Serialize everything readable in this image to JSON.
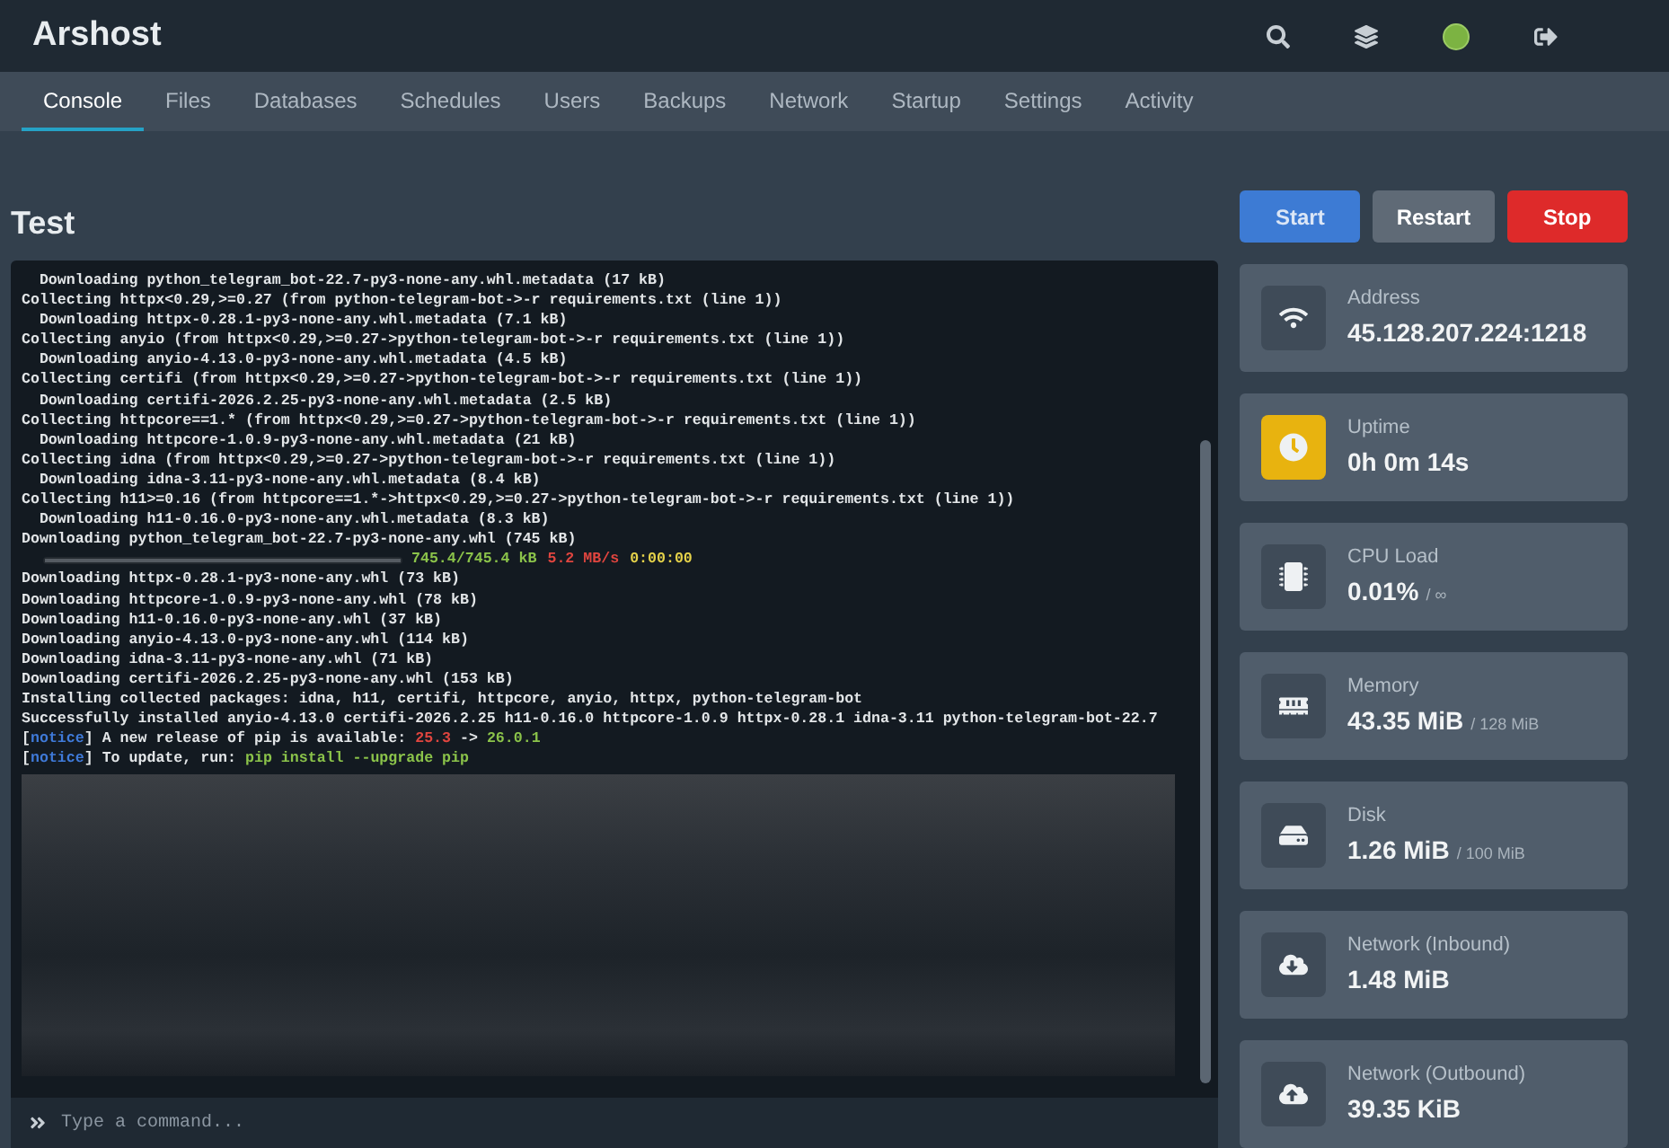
{
  "header": {
    "brand": "Arshost"
  },
  "tabs": [
    {
      "label": "Console",
      "selected": true
    },
    {
      "label": "Files",
      "selected": false
    },
    {
      "label": "Databases",
      "selected": false
    },
    {
      "label": "Schedules",
      "selected": false
    },
    {
      "label": "Users",
      "selected": false
    },
    {
      "label": "Backups",
      "selected": false
    },
    {
      "label": "Network",
      "selected": false
    },
    {
      "label": "Startup",
      "selected": false
    },
    {
      "label": "Settings",
      "selected": false
    },
    {
      "label": "Activity",
      "selected": false
    }
  ],
  "server": {
    "name": "Test"
  },
  "power_buttons": [
    {
      "label": "Start",
      "kind": "start"
    },
    {
      "label": "Restart",
      "kind": "restart"
    },
    {
      "label": "Stop",
      "kind": "stop"
    }
  ],
  "console": {
    "lines": [
      {
        "kind": "text",
        "segments": [
          {
            "text": "  Downloading python_telegram_bot-22.7-py3-none-any.whl.metadata (17 kB)"
          }
        ]
      },
      {
        "kind": "text",
        "segments": [
          {
            "text": "Collecting httpx<0.29,>=0.27 (from python-telegram-bot->-r requirements.txt (line 1))"
          }
        ]
      },
      {
        "kind": "text",
        "segments": [
          {
            "text": "  Downloading httpx-0.28.1-py3-none-any.whl.metadata (7.1 kB)"
          }
        ]
      },
      {
        "kind": "text",
        "segments": [
          {
            "text": "Collecting anyio (from httpx<0.29,>=0.27->python-telegram-bot->-r requirements.txt (line 1))"
          }
        ]
      },
      {
        "kind": "text",
        "segments": [
          {
            "text": "  Downloading anyio-4.13.0-py3-none-any.whl.metadata (4.5 kB)"
          }
        ]
      },
      {
        "kind": "text",
        "segments": [
          {
            "text": "Collecting certifi (from httpx<0.29,>=0.27->python-telegram-bot->-r requirements.txt (line 1))"
          }
        ]
      },
      {
        "kind": "text",
        "segments": [
          {
            "text": "  Downloading certifi-2026.2.25-py3-none-any.whl.metadata (2.5 kB)"
          }
        ]
      },
      {
        "kind": "text",
        "segments": [
          {
            "text": "Collecting httpcore==1.* (from httpx<0.29,>=0.27->python-telegram-bot->-r requirements.txt (line 1))"
          }
        ]
      },
      {
        "kind": "text",
        "segments": [
          {
            "text": "  Downloading httpcore-1.0.9-py3-none-any.whl.metadata (21 kB)"
          }
        ]
      },
      {
        "kind": "text",
        "segments": [
          {
            "text": "Collecting idna (from httpx<0.29,>=0.27->python-telegram-bot->-r requirements.txt (line 1))"
          }
        ]
      },
      {
        "kind": "text",
        "segments": [
          {
            "text": "  Downloading idna-3.11-py3-none-any.whl.metadata (8.4 kB)"
          }
        ]
      },
      {
        "kind": "text",
        "segments": [
          {
            "text": "Collecting h11>=0.16 (from httpcore==1.*->httpx<0.29,>=0.27->python-telegram-bot->-r requirements.txt (line 1))"
          }
        ]
      },
      {
        "kind": "text",
        "segments": [
          {
            "text": "  Downloading h11-0.16.0-py3-none-any.whl.metadata (8.3 kB)"
          }
        ]
      },
      {
        "kind": "text",
        "segments": [
          {
            "text": "Downloading python_telegram_bot-22.7-py3-none-any.whl (745 kB)"
          }
        ]
      },
      {
        "kind": "progress",
        "level": 1,
        "segments": [
          {
            "text": "745.4/745.4 kB",
            "color": "#8bc34a"
          },
          {
            "text": "5.2 MB/s",
            "color": "#e0453f"
          },
          {
            "text": "0:00:00",
            "color": "#e6d34a"
          }
        ]
      },
      {
        "kind": "text",
        "segments": [
          {
            "text": "Downloading httpx-0.28.1-py3-none-any.whl (73 kB)"
          }
        ]
      },
      {
        "kind": "text",
        "segments": [
          {
            "text": "Downloading httpcore-1.0.9-py3-none-any.whl (78 kB)"
          }
        ]
      },
      {
        "kind": "text",
        "segments": [
          {
            "text": "Downloading h11-0.16.0-py3-none-any.whl (37 kB)"
          }
        ]
      },
      {
        "kind": "text",
        "segments": [
          {
            "text": "Downloading anyio-4.13.0-py3-none-any.whl (114 kB)"
          }
        ]
      },
      {
        "kind": "text",
        "segments": [
          {
            "text": "Downloading idna-3.11-py3-none-any.whl (71 kB)"
          }
        ]
      },
      {
        "kind": "text",
        "segments": [
          {
            "text": "Downloading certifi-2026.2.25-py3-none-any.whl (153 kB)"
          }
        ]
      },
      {
        "kind": "text",
        "segments": [
          {
            "text": "Installing collected packages: idna, h11, certifi, httpcore, anyio, httpx, python-telegram-bot"
          }
        ]
      },
      {
        "kind": "text",
        "segments": [
          {
            "text": "Successfully installed anyio-4.13.0 certifi-2026.2.25 h11-0.16.0 httpcore-1.0.9 httpx-0.28.1 idna-3.11 python-telegram-bot-22.7"
          }
        ]
      },
      {
        "kind": "text",
        "segments": [
          {
            "text": "["
          },
          {
            "text": "notice",
            "color": "#3f7ad9"
          },
          {
            "text": "] A new release of pip is available: "
          },
          {
            "text": "25.3",
            "color": "#e0453f"
          },
          {
            "text": " -> "
          },
          {
            "text": "26.0.1",
            "color": "#8bc34a"
          }
        ]
      },
      {
        "kind": "text",
        "segments": [
          {
            "text": "["
          },
          {
            "text": "notice",
            "color": "#3f7ad9"
          },
          {
            "text": "] To update, run: "
          },
          {
            "text": "pip install --upgrade pip",
            "color": "#8bc34a"
          }
        ]
      }
    ],
    "command_placeholder": "Type a command..."
  },
  "stats": [
    {
      "kind": "address",
      "label": "Address",
      "value": "45.128.207.224:1218",
      "highlighted": false
    },
    {
      "kind": "uptime",
      "label": "Uptime",
      "value": "0h 0m 14s",
      "highlighted": true
    },
    {
      "kind": "cpu",
      "label": "CPU Load",
      "value": "0.01%",
      "limit": "/ ∞",
      "highlighted": false
    },
    {
      "kind": "memory",
      "label": "Memory",
      "value": "43.35 MiB",
      "limit": "/ 128 MiB",
      "highlighted": false
    },
    {
      "kind": "disk",
      "label": "Disk",
      "value": "1.26 MiB",
      "limit": "/ 100 MiB",
      "highlighted": false
    },
    {
      "kind": "inbound",
      "label": "Network (Inbound)",
      "value": "1.48 MiB",
      "highlighted": false
    },
    {
      "kind": "outbound",
      "label": "Network (Outbound)",
      "value": "39.35 KiB",
      "highlighted": false
    }
  ]
}
